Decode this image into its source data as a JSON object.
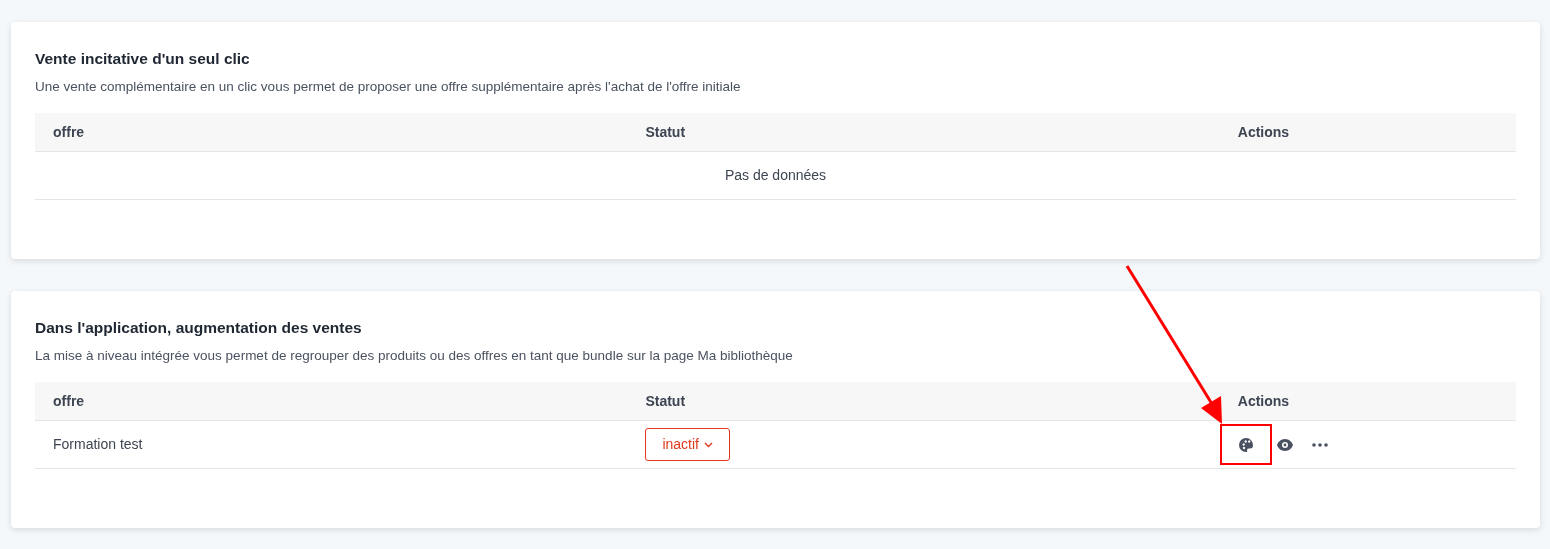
{
  "sections": [
    {
      "title": "Vente incitative d'un seul clic",
      "description": "Une vente complémentaire en un clic vous permet de proposer une offre supplémentaire après l'achat de l'offre initiale",
      "columns": [
        "offre",
        "Statut",
        "Actions"
      ],
      "empty_text": "Pas de données"
    },
    {
      "title": "Dans l'application, augmentation des ventes",
      "description": "La mise à niveau intégrée vous permet de regrouper des produits ou des offres en tant que bundle sur la page Ma bibliothèque",
      "columns": [
        "offre",
        "Statut",
        "Actions"
      ],
      "rows": [
        {
          "offer": "Formation test",
          "status": "inactif",
          "actions": [
            {
              "kind": "palette",
              "highlighted": true
            },
            {
              "kind": "eye",
              "highlighted": false
            },
            {
              "kind": "more",
              "highlighted": false
            }
          ]
        }
      ]
    }
  ]
}
